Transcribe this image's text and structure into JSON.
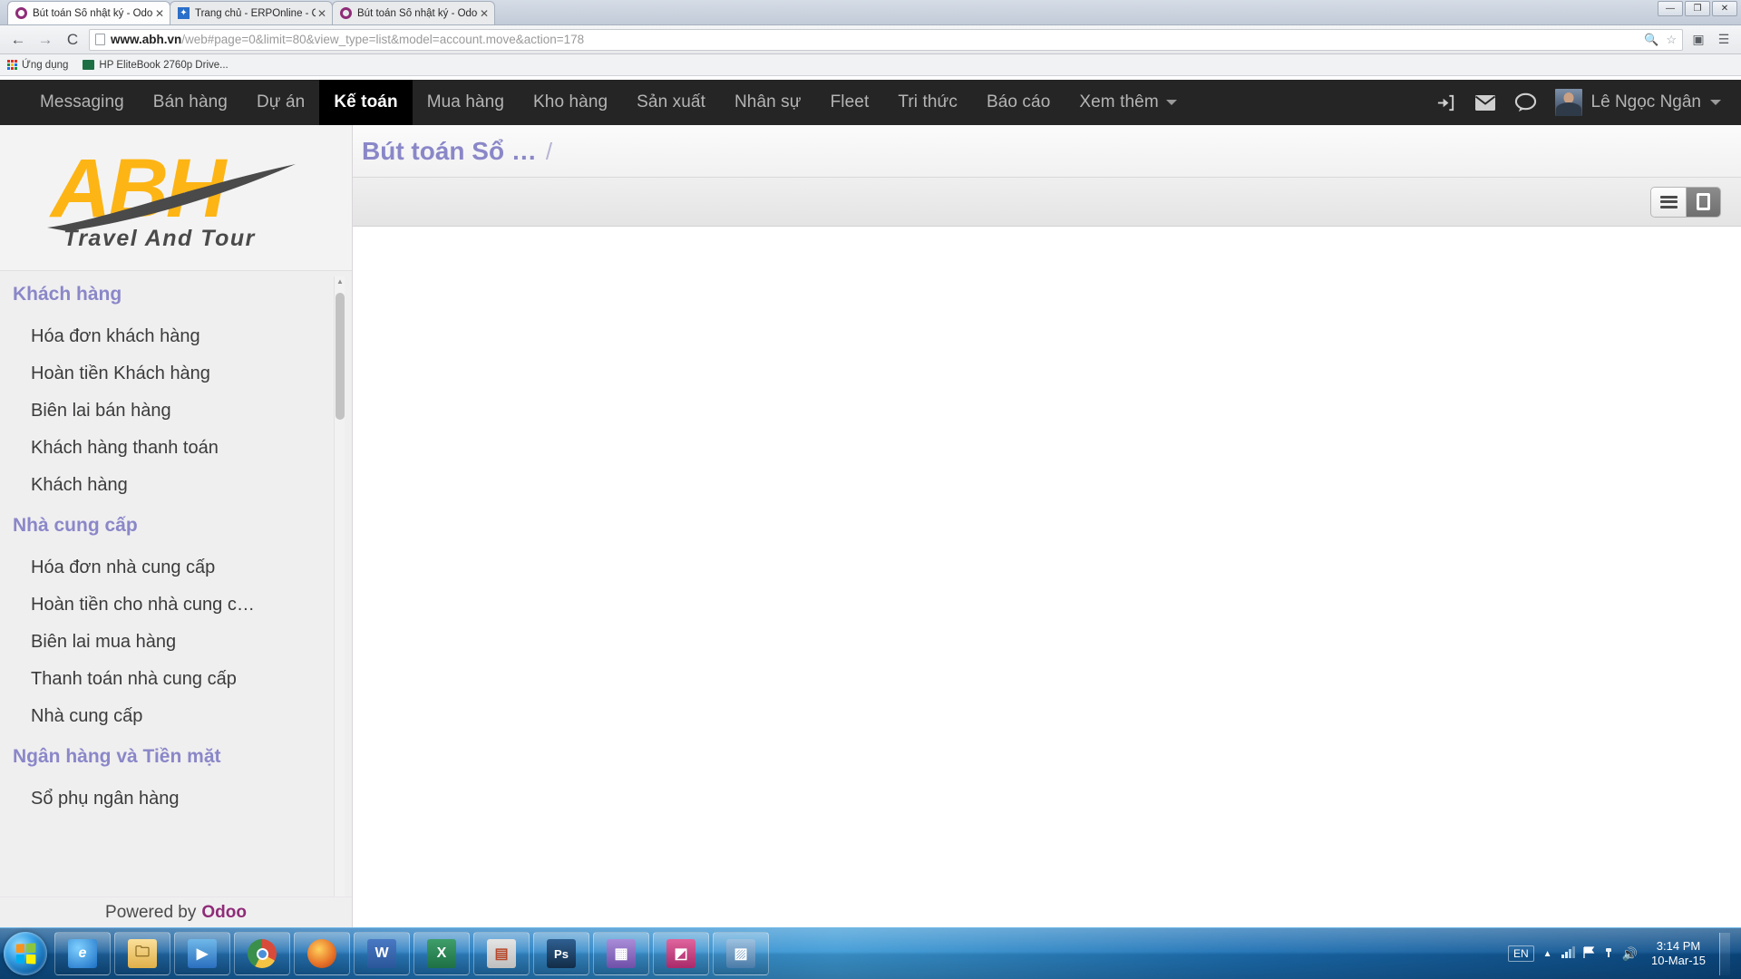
{
  "browser": {
    "tabs": [
      {
        "title": "Bút toán Sổ nhật ký - Odoo",
        "favicon": "odoo-icon",
        "active": true
      },
      {
        "title": "Trang chủ - ERPOnline - Quản",
        "favicon": "erponline-icon",
        "active": false
      },
      {
        "title": "Bút toán Sổ nhật ký - Odoo",
        "favicon": "odoo-icon",
        "active": false
      }
    ],
    "close_label": "✕",
    "window_controls": {
      "minimize": "—",
      "maximize": "❐",
      "close": "✕"
    },
    "nav": {
      "back": "←",
      "forward": "→",
      "reload": "C"
    },
    "url_domain": "www.abh.vn",
    "url_path": "/web#page=0&limit=80&view_type=list&model=account.move&action=178",
    "omnibox_icons": {
      "zoom": "🔍",
      "star": "☆",
      "extension": "▣",
      "menu": "☰"
    },
    "bookmarks": [
      {
        "label": "Ứng dụng",
        "icon": "apps-grid-icon"
      },
      {
        "label": "HP EliteBook 2760p Drive...",
        "icon": "excel-icon"
      }
    ]
  },
  "odoo": {
    "menus": [
      {
        "label": "Messaging",
        "active": false
      },
      {
        "label": "Bán hàng",
        "active": false
      },
      {
        "label": "Dự án",
        "active": false
      },
      {
        "label": "Kế toán",
        "active": true
      },
      {
        "label": "Mua hàng",
        "active": false
      },
      {
        "label": "Kho hàng",
        "active": false
      },
      {
        "label": "Sản xuất",
        "active": false
      },
      {
        "label": "Nhân sự",
        "active": false
      },
      {
        "label": "Fleet",
        "active": false
      },
      {
        "label": "Tri thức",
        "active": false
      },
      {
        "label": "Báo cáo",
        "active": false
      },
      {
        "label": "Xem thêm",
        "active": false,
        "has_caret": true
      }
    ],
    "systray": {
      "login_icon": "sign-in-icon",
      "mail_icon": "envelope-icon",
      "chat_icon": "chat-bubble-icon",
      "user_name": "Lê Ngọc Ngân"
    },
    "logo": {
      "brand": "ABH",
      "tagline": "Travel And Tour",
      "brand_color": "#FDB515",
      "swoosh_color": "#4a4a4a"
    },
    "sidebar": {
      "sections": [
        {
          "title": "Khách hàng",
          "items": [
            "Hóa đơn khách hàng",
            "Hoàn tiền Khách hàng",
            "Biên lai bán hàng",
            "Khách hàng thanh toán",
            "Khách hàng"
          ]
        },
        {
          "title": "Nhà cung cấp",
          "items": [
            "Hóa đơn nhà cung cấp",
            "Hoàn tiền cho nhà cung c…",
            "Biên lai mua hàng",
            "Thanh toán nhà cung cấp",
            "Nhà cung cấp"
          ]
        },
        {
          "title": "Ngân hàng và Tiền mặt",
          "items": [
            "Sổ phụ ngân hàng"
          ]
        }
      ],
      "powered_prefix": "Powered by",
      "powered_brand": "Odoo",
      "scroll_up": "▲",
      "scroll_down": "▼"
    },
    "content": {
      "breadcrumb_title": "Bút toán Sổ …",
      "breadcrumb_separator": "/",
      "view_switch": [
        {
          "name": "list-view",
          "icon": "list-icon",
          "active": false
        },
        {
          "name": "form-view",
          "icon": "form-icon",
          "active": true
        }
      ]
    }
  },
  "taskbar": {
    "start_label": "Start",
    "items": [
      {
        "name": "internet-explorer",
        "glyph": "e",
        "color": "#1b6fc4"
      },
      {
        "name": "windows-explorer",
        "glyph": "🗂",
        "color": "#e8c45a"
      },
      {
        "name": "media-player",
        "glyph": "▶",
        "color": "#2a6fbf"
      },
      {
        "name": "google-chrome",
        "glyph": "◉",
        "color": "#d84b3a"
      },
      {
        "name": "mozilla-firefox",
        "glyph": "◔",
        "color": "#e8772b"
      },
      {
        "name": "microsoft-word",
        "glyph": "W",
        "color": "#2a5699"
      },
      {
        "name": "microsoft-excel",
        "glyph": "X",
        "color": "#1d7044"
      },
      {
        "name": "microsoft-powerpoint",
        "glyph": "▤",
        "color": "#b7472a"
      },
      {
        "name": "adobe-photoshop",
        "glyph": "Ps",
        "color": "#1a3a5c"
      },
      {
        "name": "calculator",
        "glyph": "▦",
        "color": "#7a5ca8"
      },
      {
        "name": "unikey",
        "glyph": "◩",
        "color": "#c23a7a"
      },
      {
        "name": "picture-viewer",
        "glyph": "▨",
        "color": "#5a8bbd"
      }
    ],
    "tray": {
      "language": "EN",
      "show_hidden": "▲",
      "network_icon": "network-icon",
      "action_center_icon": "flag-icon",
      "usb_icon": "usb-icon",
      "volume_icon": "🔊",
      "time": "3:14 PM",
      "date": "10-Mar-15"
    }
  }
}
